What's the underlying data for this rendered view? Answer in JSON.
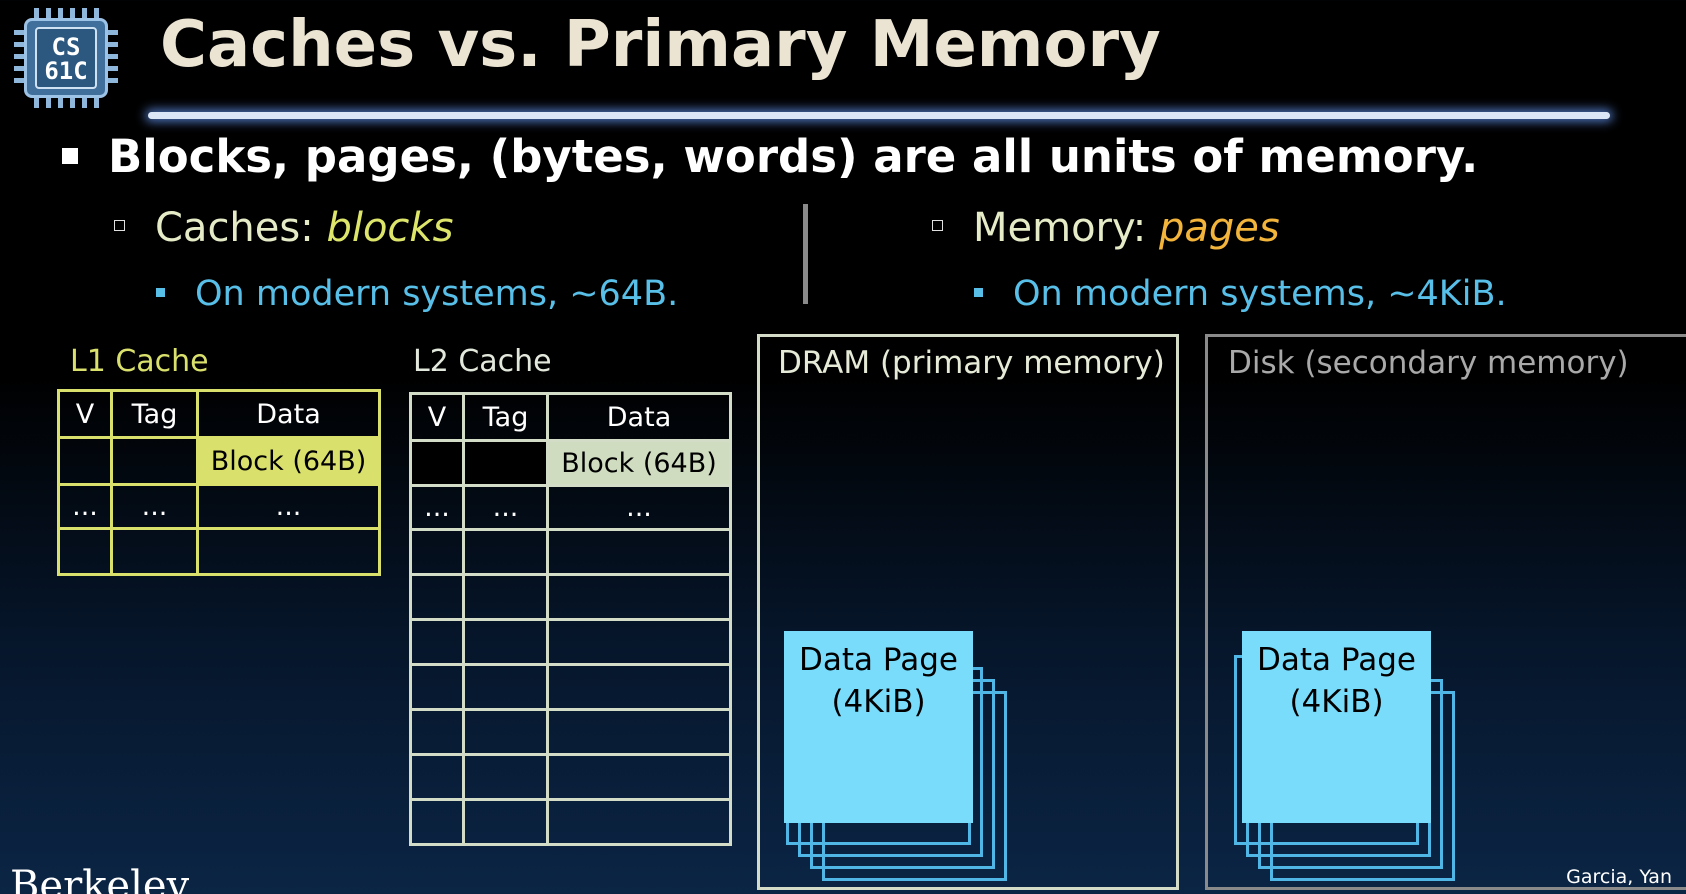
{
  "logo": {
    "text": "CS 61C",
    "line1": "CS",
    "line2": "61C"
  },
  "title": "Caches vs. Primary Memory",
  "bullet1": "Blocks, pages, (bytes, words) are all units of memory.",
  "left": {
    "label": "Caches:",
    "emphasis": "blocks",
    "sub": "On modern systems, ~64B."
  },
  "right": {
    "label": "Memory:",
    "emphasis": "pages",
    "sub": "On modern systems, ~4KiB."
  },
  "l1": {
    "caption": "L1 Cache",
    "headers": [
      "V",
      "Tag",
      "Data"
    ],
    "block": "Block (64B)",
    "ellipsis": "..."
  },
  "l2": {
    "caption": "L2 Cache",
    "headers": [
      "V",
      "Tag",
      "Data"
    ],
    "block": "Block (64B)",
    "ellipsis": "..."
  },
  "dram": {
    "label": "DRAM (primary memory)",
    "page": "Data Page (4KiB)"
  },
  "disk": {
    "label": "Disk (secondary memory)",
    "page": "Data Page (4KiB)"
  },
  "footer": {
    "credit": "Garcia, Yan",
    "institution": "Berkeley"
  },
  "colors": {
    "l1_accent": "#d9e06c",
    "l2_accent": "#d3dcc7",
    "sub_bullet": "#58bfe8",
    "pages_emphasis": "#f2b43a",
    "page_fill": "#79dcfb"
  }
}
